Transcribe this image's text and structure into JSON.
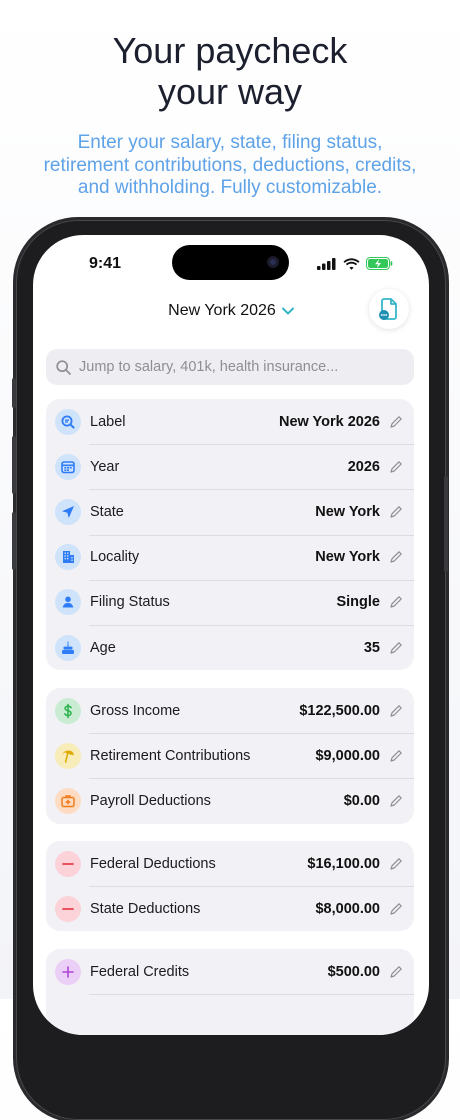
{
  "headline": {
    "line1": "Your paycheck",
    "line2": "your way"
  },
  "subhead": {
    "line1": "Enter your salary, state, filing status,",
    "line2": "retirement contributions, deductions, credits,",
    "line3": "and withholding. Fully customizable."
  },
  "status_bar": {
    "time": "9:41"
  },
  "nav": {
    "title": "New York 2026",
    "chevron_icon": "chevron-down-icon",
    "action_icon": "document-more-icon"
  },
  "search": {
    "placeholder": "Jump to salary, 401k, health insurance..."
  },
  "groups": [
    {
      "rows": [
        {
          "label": "Label",
          "value": "New York 2026",
          "icon": "magnifier-icon",
          "color": "#2f7df6"
        },
        {
          "label": "Year",
          "value": "2026",
          "icon": "calendar-icon",
          "color": "#2f7df6"
        },
        {
          "label": "State",
          "value": "New York",
          "icon": "location-arrow-icon",
          "color": "#2f7df6"
        },
        {
          "label": "Locality",
          "value": "New York",
          "icon": "building-icon",
          "color": "#2f7df6"
        },
        {
          "label": "Filing Status",
          "value": "Single",
          "icon": "person-icon",
          "color": "#2f7df6"
        },
        {
          "label": "Age",
          "value": "35",
          "icon": "birthday-cake-icon",
          "color": "#2f7df6"
        }
      ]
    },
    {
      "rows": [
        {
          "label": "Gross Income",
          "value": "$122,500.00",
          "icon": "dollar-sign-icon",
          "color": "#2fb34f"
        },
        {
          "label": "Retirement Contributions",
          "value": "$9,000.00",
          "icon": "beach-umbrella-icon",
          "color": "#e0a800"
        },
        {
          "label": "Payroll Deductions",
          "value": "$0.00",
          "icon": "medical-bag-icon",
          "color": "#f27b1c"
        }
      ]
    },
    {
      "rows": [
        {
          "label": "Federal Deductions",
          "value": "$16,100.00",
          "icon": "minus-circle-icon",
          "color": "#e8414d"
        },
        {
          "label": "State Deductions",
          "value": "$8,000.00",
          "icon": "minus-circle-icon",
          "color": "#e8414d"
        }
      ]
    },
    {
      "rows": [
        {
          "label": "Federal Credits",
          "value": "$500.00",
          "icon": "plus-circle-icon",
          "color": "#b044d8"
        }
      ]
    }
  ]
}
